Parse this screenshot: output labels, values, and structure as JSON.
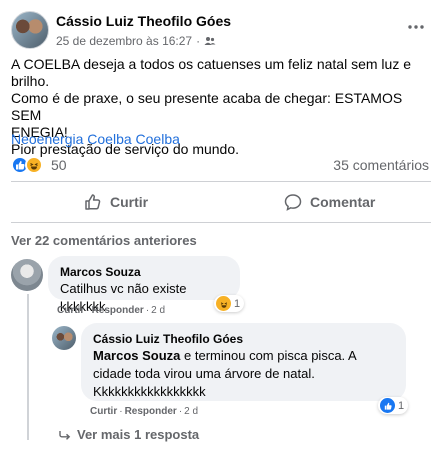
{
  "post": {
    "author": "Cássio Luiz Theofilo Góes",
    "date": "25 de dezembro às 16:27",
    "dot": "·",
    "text_lines": [
      "A COELBA deseja a todos os catuenses um feliz natal sem luz e brilho.",
      "Como é de praxe, o seu presente acaba de chegar: ESTAMOS SEM",
      "ENEGIA!",
      "Pior prestação de serviço do mundo."
    ],
    "tags": "Neoenergia Coelba Coelba",
    "reaction_count": "50",
    "comments_count": "35 comentários",
    "like_label": "Curtir",
    "comment_label": "Comentar",
    "accent": "#1877f2",
    "link_color": "#216fdb"
  },
  "comments": {
    "view_previous": "Ver 22 comentários anteriores",
    "first": {
      "author": "Marcos Souza",
      "text": "Catilhus vc não existe kkkkkkk",
      "like": "Curtir",
      "reply": "Responder",
      "sep": "·",
      "age": "2 d",
      "reaction_count": "1",
      "reaction_icon": "haha-icon"
    },
    "reply": {
      "author": "Cássio Luiz Theofilo Góes",
      "mention": "Marcos Souza",
      "text": " e terminou com pisca pisca. A cidade toda virou uma árvore de natal. Kkkkkkkkkkkkkkkkk",
      "like": "Curtir",
      "reply": "Responder",
      "sep": "·",
      "age": "2 d",
      "reaction_count": "1",
      "reaction_icon": "like-icon"
    },
    "view_more_replies": "Ver mais 1 resposta"
  }
}
